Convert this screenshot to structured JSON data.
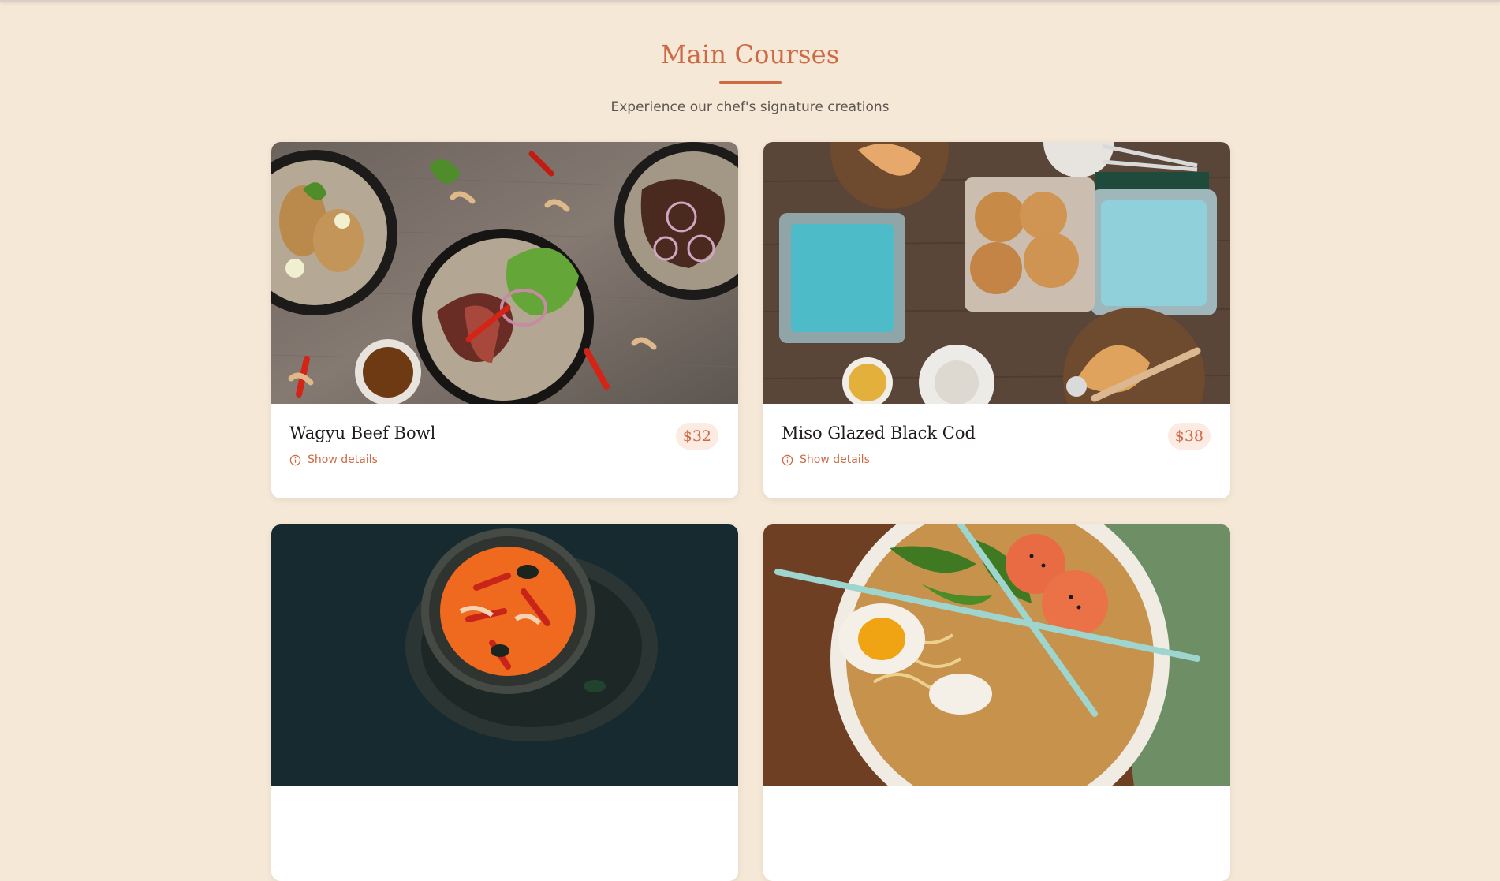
{
  "section": {
    "title": "Main Courses",
    "subtitle": "Experience our chef's signature creations"
  },
  "dishes": [
    {
      "name": "Wagyu Beef Bowl",
      "price": "$32",
      "details_label": "Show details",
      "image": "steak-salad-bowls-photo"
    },
    {
      "name": "Miso Glazed Black Cod",
      "price": "$38",
      "details_label": "Show details",
      "image": "bread-basket-table-photo"
    },
    {
      "image": "tom-yum-soup-photo"
    },
    {
      "image": "shrimp-ramen-chopsticks-photo"
    }
  ],
  "colors": {
    "background": "#f5e8d7",
    "accent": "#cd6a45",
    "card": "#ffffff",
    "price_badge_bg": "#fbebe3"
  },
  "icons": {
    "details": "info-circle-icon"
  }
}
